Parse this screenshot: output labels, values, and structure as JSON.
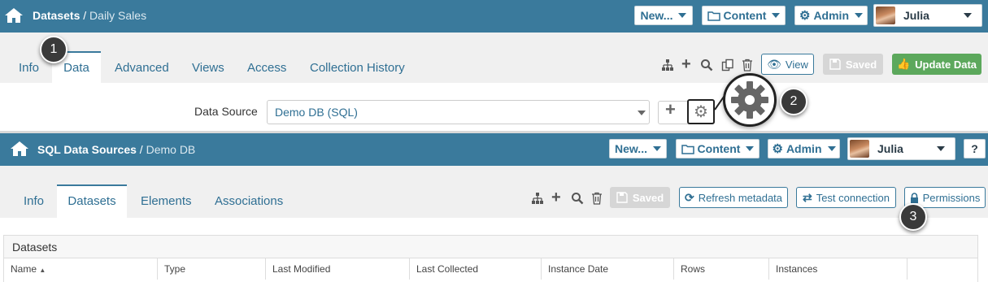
{
  "top": {
    "breadcrumb_root": "Datasets",
    "breadcrumb_sep": "/",
    "breadcrumb_current": "Daily Sales",
    "new_label": "New...",
    "content_label": "Content",
    "admin_label": "Admin",
    "user_label": "Julia"
  },
  "top_tabs": [
    "Info",
    "Data",
    "Advanced",
    "Views",
    "Access",
    "Collection History"
  ],
  "top_actions": {
    "view_label": "View",
    "saved_label": "Saved",
    "update_label": "Update Data"
  },
  "data_source": {
    "label": "Data Source",
    "value": "Demo DB (SQL)"
  },
  "callouts": [
    "1",
    "2",
    "3"
  ],
  "bottom": {
    "breadcrumb_root": "SQL Data Sources",
    "breadcrumb_sep": "/",
    "breadcrumb_current": "Demo DB",
    "new_label": "New...",
    "content_label": "Content",
    "admin_label": "Admin",
    "user_label": "Julia",
    "help_label": "?"
  },
  "bottom_tabs": [
    "Info",
    "Datasets",
    "Elements",
    "Associations"
  ],
  "bottom_actions": {
    "saved_label": "Saved",
    "refresh_label": "Refresh metadata",
    "test_label": "Test connection",
    "permissions_label": "Permissions"
  },
  "panel": {
    "title": "Datasets",
    "columns": [
      "Name",
      "Type",
      "Last Modified",
      "Last Collected",
      "Instance Date",
      "Rows",
      "Instances"
    ]
  },
  "colors": {
    "header": "#3a7a9c",
    "green": "#5ca85c"
  }
}
